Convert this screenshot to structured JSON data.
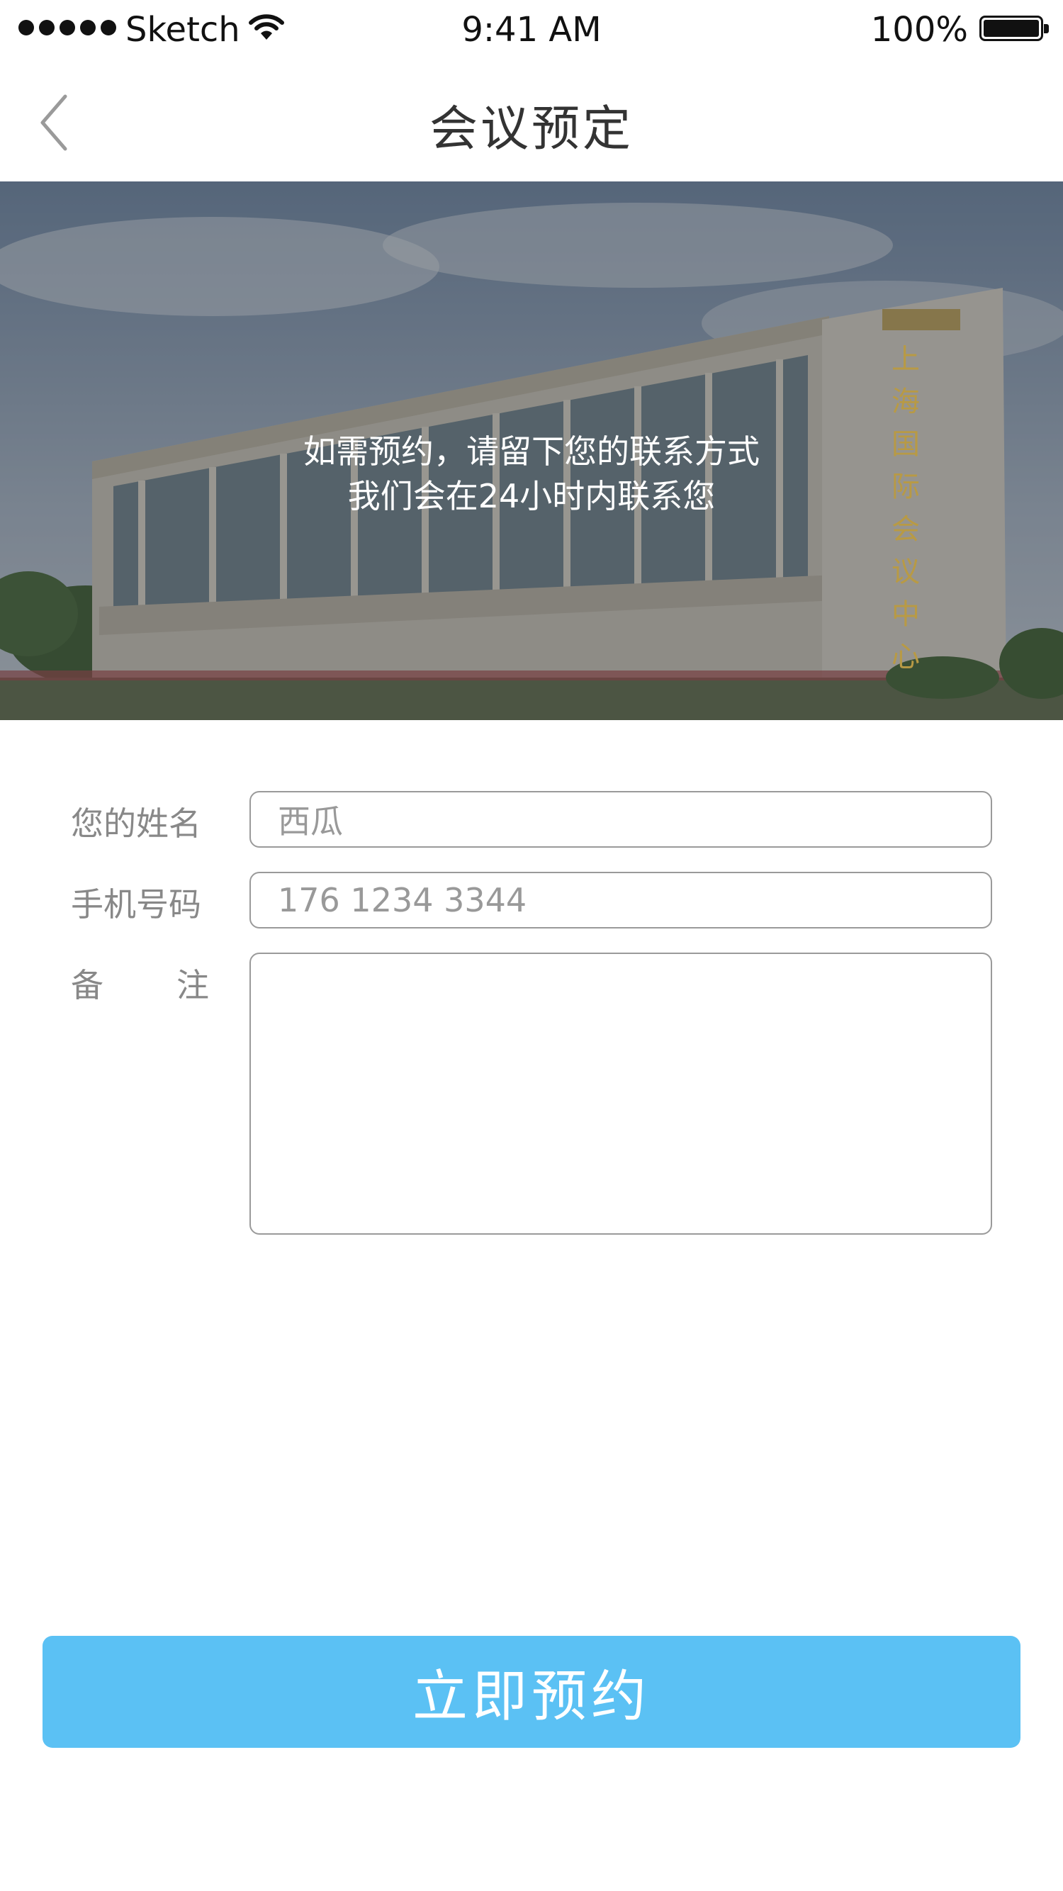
{
  "status_bar": {
    "carrier": "Sketch",
    "time": "9:41 AM",
    "battery": "100%"
  },
  "nav": {
    "title": "会议预定",
    "back_icon": "chevron-left-icon"
  },
  "hero": {
    "line1": "如需预约，请留下您的联系方式",
    "line2": "我们会在24小时内联系您",
    "sign_chars": [
      "上",
      "海",
      "国",
      "际",
      "会",
      "议",
      "中",
      "心"
    ]
  },
  "form": {
    "name_label": "您的姓名",
    "name_value": "西瓜",
    "phone_label": "手机号码",
    "phone_placeholder": "176 1234 3344",
    "notes_label_1": "备",
    "notes_label_2": "注",
    "notes_value": ""
  },
  "submit": {
    "label": "立即预约"
  },
  "colors": {
    "accent": "#5bc1f4",
    "label": "#888888",
    "border": "#9a9a9a"
  }
}
